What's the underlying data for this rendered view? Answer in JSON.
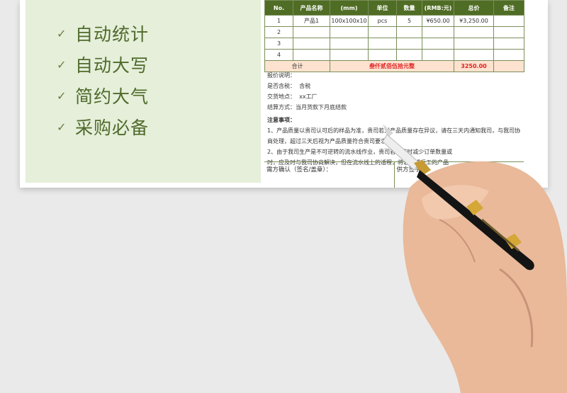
{
  "features": [
    "自动统计",
    "自动大写",
    "简约大气",
    "采购必备"
  ],
  "table": {
    "headers": [
      "No.",
      "产品名称",
      "(mm)",
      "单位",
      "数量",
      "(RMB:元)",
      "总价",
      "备注"
    ],
    "rows": [
      [
        "1",
        "产品1",
        "100x100x10",
        "pcs",
        "5",
        "¥650.00",
        "¥3,250.00",
        ""
      ],
      [
        "2",
        "",
        "",
        "",
        "",
        "",
        "",
        ""
      ],
      [
        "3",
        "",
        "",
        "",
        "",
        "",
        "",
        ""
      ],
      [
        "4",
        "",
        "",
        "",
        "",
        "",
        "",
        ""
      ]
    ],
    "total_label": "合计",
    "total_upper": "叁仟贰佰伍拾元整",
    "total_value": "3250.00"
  },
  "notes": {
    "quote_note": "报价说明：",
    "tax_label": "是否含税：",
    "tax_value": "含税",
    "delivery_label": "交货地点：",
    "delivery_value": "xx工厂",
    "payment_label": "结算方式：",
    "payment_value": "当月货款下月底结款",
    "attention_title": "注意事项：",
    "item1_a": "1、产品质量以贵司认可后的样品为准，贵司若对产品质量存在异议，请在三天内通知我司，与我司协",
    "item1_b": "商处理，超过三天后视为产品质量符合贵司要求。",
    "item2_a": "2、由于我司生产是不可逆转的流水线作业，贵司若要临时减少订单数量或",
    "item2_b": "时，应及时与我司协商解决，但在流水线上的适程，将若改或返工的产品"
  },
  "sign": {
    "buyer": "需方确认（签名/盖章）：",
    "supplier": "供方签字："
  }
}
